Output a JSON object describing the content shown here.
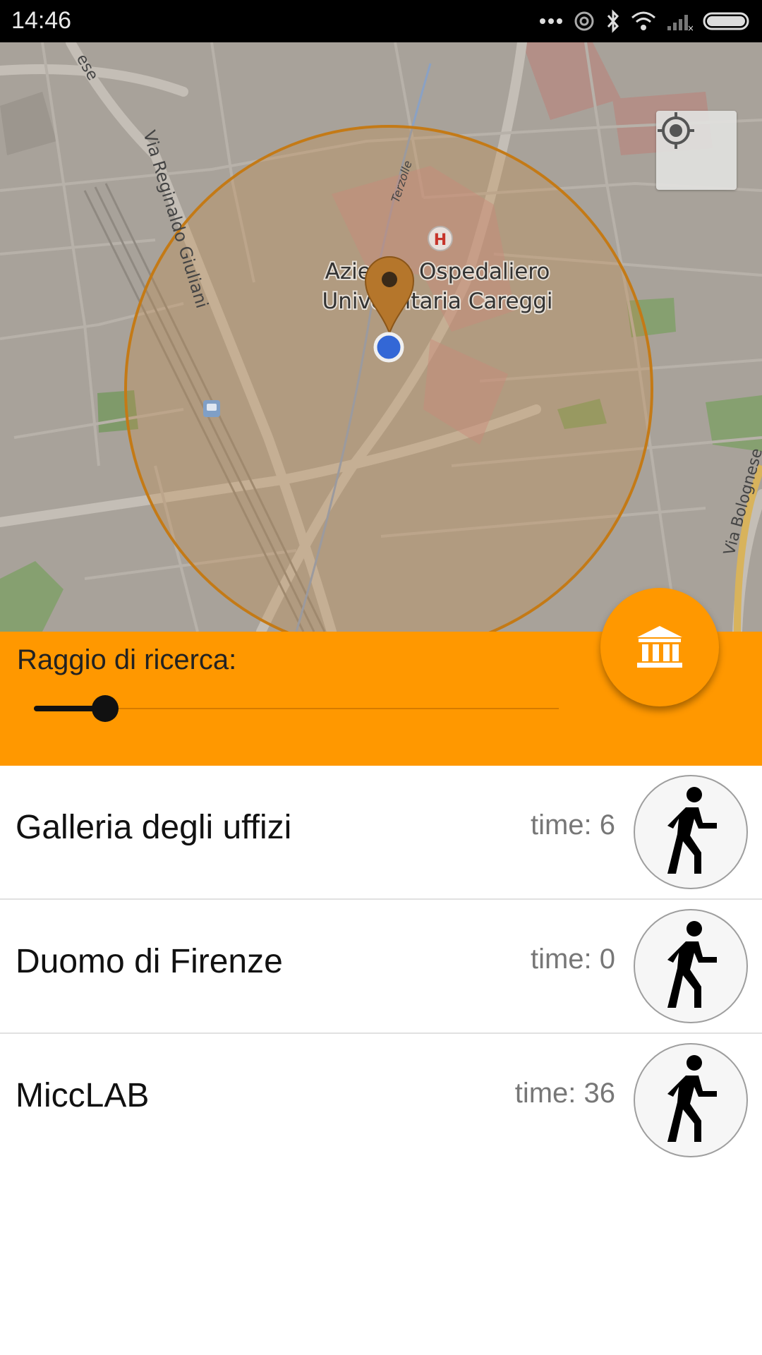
{
  "status_bar": {
    "time": "14:46",
    "icons": [
      "more-dots-icon",
      "hotspot-icon",
      "bluetooth-icon",
      "wifi-icon",
      "signal-icon",
      "battery-icon"
    ]
  },
  "map": {
    "labels": {
      "street_1": "Via Reginaldo Giuliani",
      "street_2": "Terzolle",
      "street_3": "Via Bolognese",
      "street_4": "ese",
      "poi_line1": "Azienda Ospedaliero",
      "poi_line2": "Universitaria Careggi"
    },
    "search_circle_color": "#c47a16",
    "marker_color": "#b5762b",
    "user_dot_color": "#3367d6"
  },
  "search_panel": {
    "label": "Raggio di ricerca:",
    "slider_value_fraction": 0.11,
    "color": "#ff9800"
  },
  "places": [
    {
      "name": "Galleria degli uffizi",
      "time": "time: 6"
    },
    {
      "name": "Duomo di Firenze",
      "time": "time: 0"
    },
    {
      "name": "MiccLAB",
      "time": "time: 36"
    }
  ]
}
